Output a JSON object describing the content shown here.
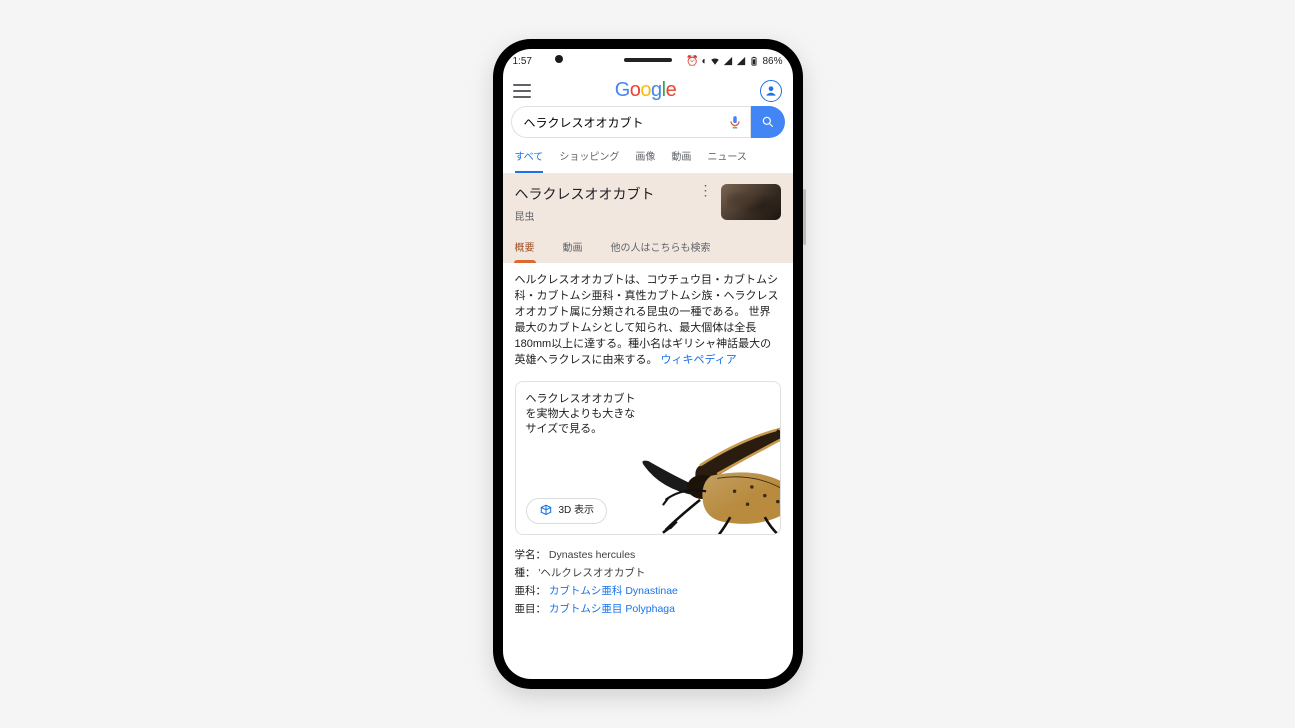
{
  "statusbar": {
    "time": "1:57",
    "battery": "86%"
  },
  "header": {
    "logo": "Google"
  },
  "search": {
    "query": "ヘラクレスオオカブト"
  },
  "category_tabs": {
    "all": "すべて",
    "shopping": "ショッピング",
    "images": "画像",
    "videos": "動画",
    "news": "ニュース"
  },
  "kp": {
    "title": "ヘラクレスオオカブト",
    "subtitle": "昆虫",
    "tabs": {
      "overview": "概要",
      "videos": "動画",
      "people_also_search": "他の人はこちらも検索"
    },
    "description": "ヘルクレスオオカブトは、コウチュウ目・カブトムシ科・カブトムシ亜科・真性カブトムシ族・ヘラクレスオオカブト属に分類される昆虫の一種である。 世界最大のカブトムシとして知られ、最大個体は全長180mm以上に達する。種小名はギリシャ神話最大の英雄ヘラクレスに由来する。",
    "wiki_label": "ウィキペディア",
    "ar": {
      "text": "ヘラクレスオオカブトを実物大よりも大きなサイズで見る。",
      "button": "3D 表示"
    },
    "facts": {
      "sci_name_label": "学名：",
      "sci_name_value": "Dynastes hercules",
      "species_label": "種：",
      "species_value": "'ヘルクレスオオカブト",
      "subfamily_label": "亜科：",
      "subfamily_value": "カブトムシ亜科 Dynastinae",
      "suborder_label": "亜目：",
      "suborder_value": "カブトムシ亜目 Polyphaga"
    }
  }
}
